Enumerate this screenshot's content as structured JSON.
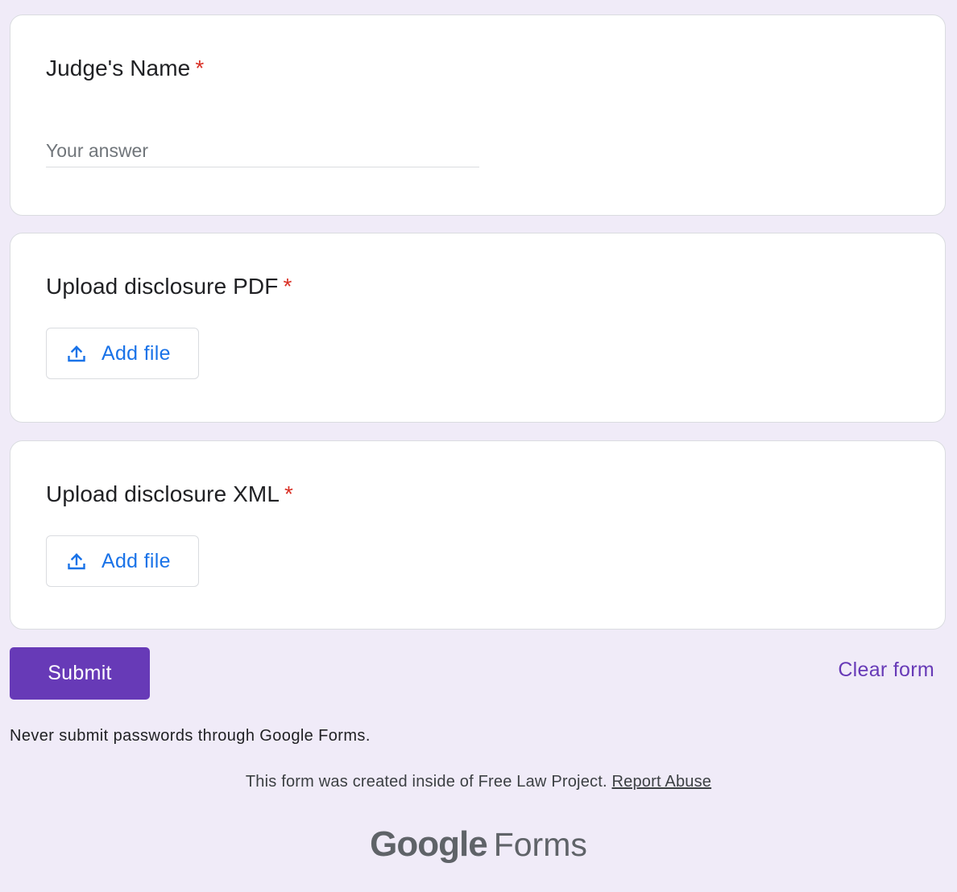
{
  "questions": [
    {
      "title": "Judge's Name",
      "required_mark": "*",
      "placeholder": "Your answer",
      "value": ""
    },
    {
      "title": "Upload disclosure PDF",
      "required_mark": "*",
      "button_label": "Add file"
    },
    {
      "title": "Upload disclosure XML",
      "required_mark": "*",
      "button_label": "Add file"
    }
  ],
  "actions": {
    "submit_label": "Submit",
    "clear_label": "Clear form"
  },
  "footer": {
    "warning": "Never submit passwords through Google Forms.",
    "created_text": "This form was created inside of Free Law Project.",
    "report_label": "Report Abuse",
    "logo_google": "Google",
    "logo_forms": "Forms"
  },
  "icons": {
    "upload": "upload-icon"
  },
  "colors": {
    "background": "#f0ebf8",
    "accent": "#673ab7",
    "link_blue": "#1a73e8",
    "required_red": "#d93025"
  }
}
